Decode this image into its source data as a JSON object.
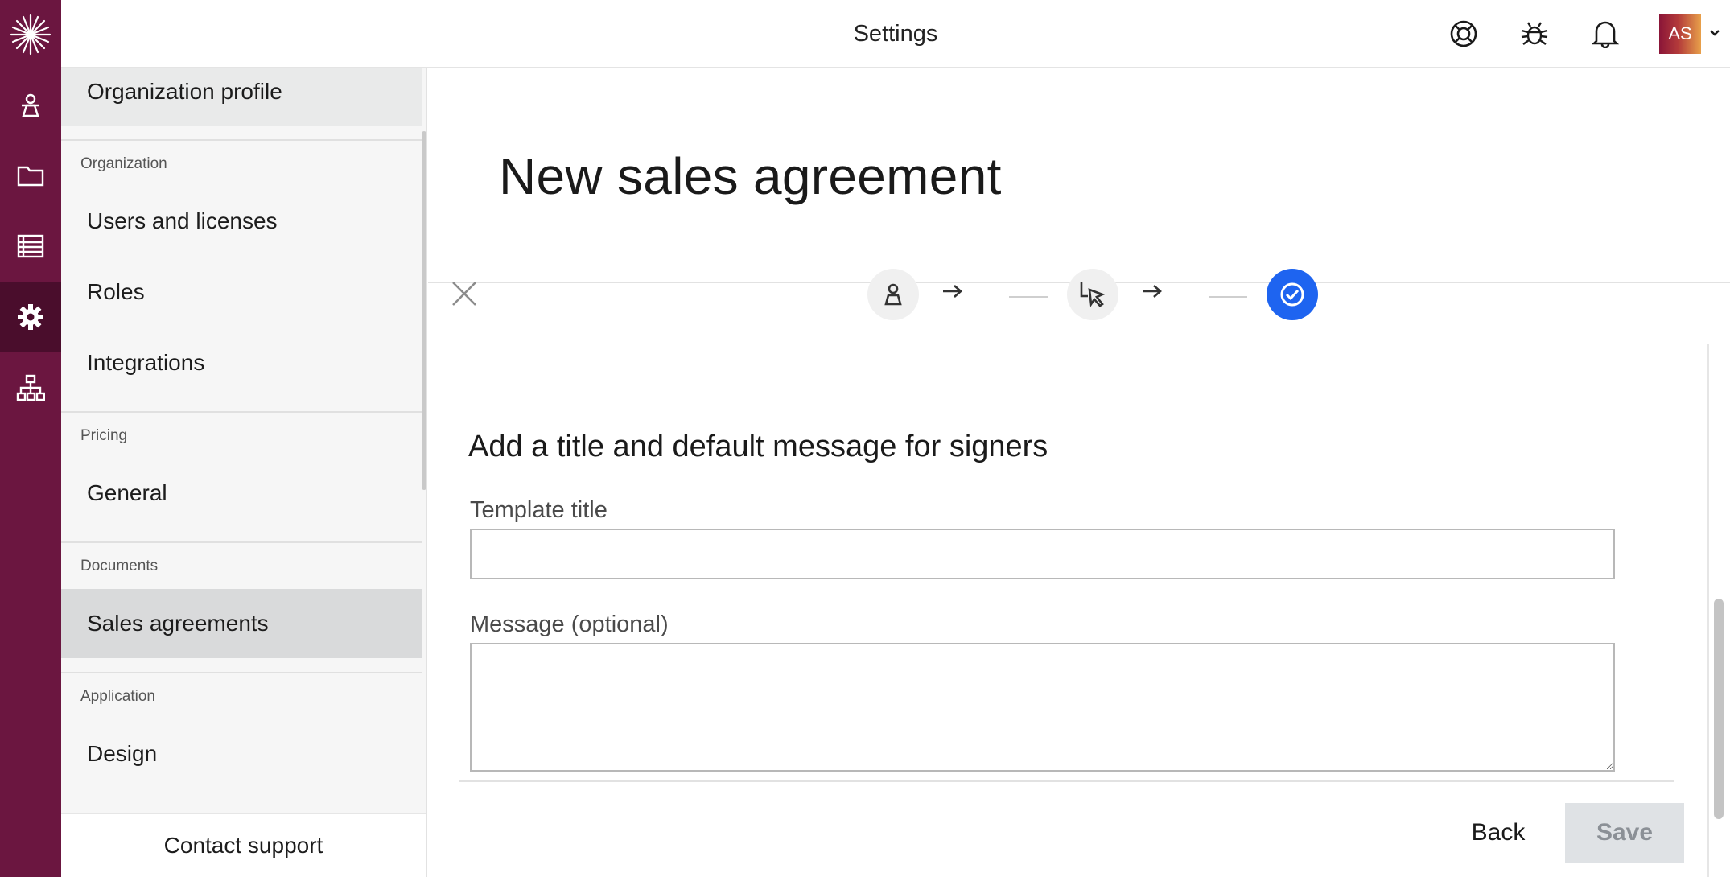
{
  "header": {
    "title": "Settings",
    "avatar_initials": "AS",
    "icons": [
      "help-icon",
      "bug-icon",
      "bell-icon",
      "chevron-down-icon"
    ]
  },
  "rail": {
    "items": [
      "logo-icon",
      "contacts-icon",
      "folder-icon",
      "database-icon",
      "settings-gear-icon",
      "org-chart-icon"
    ],
    "active": "settings-gear-icon"
  },
  "nav": {
    "items": {
      "org_profile": "Organization profile",
      "users": "Users and licenses",
      "roles": "Roles",
      "integrations": "Integrations",
      "general": "General",
      "sales_agreements": "Sales agreements",
      "design": "Design"
    },
    "sections": {
      "organization": "Organization",
      "pricing": "Pricing",
      "documents": "Documents",
      "application": "Application"
    },
    "selected": "Sales agreements",
    "footer": "Contact support"
  },
  "main": {
    "title": "New sales agreement",
    "stepper": [
      "signer-icon",
      "pointer-icon",
      "check-icon"
    ],
    "current_step": 3,
    "section_title": "Add a title and default message for signers",
    "template_title_label": "Template title",
    "template_title_value": "",
    "message_label": "Message (optional)",
    "message_value": "",
    "back_label": "Back",
    "save_label": "Save"
  },
  "colors": {
    "rail": "#6b1640",
    "rail_active": "#4a0d2c",
    "step_done": "#1e64f0",
    "save_disabled_bg": "#dfe2e5"
  }
}
